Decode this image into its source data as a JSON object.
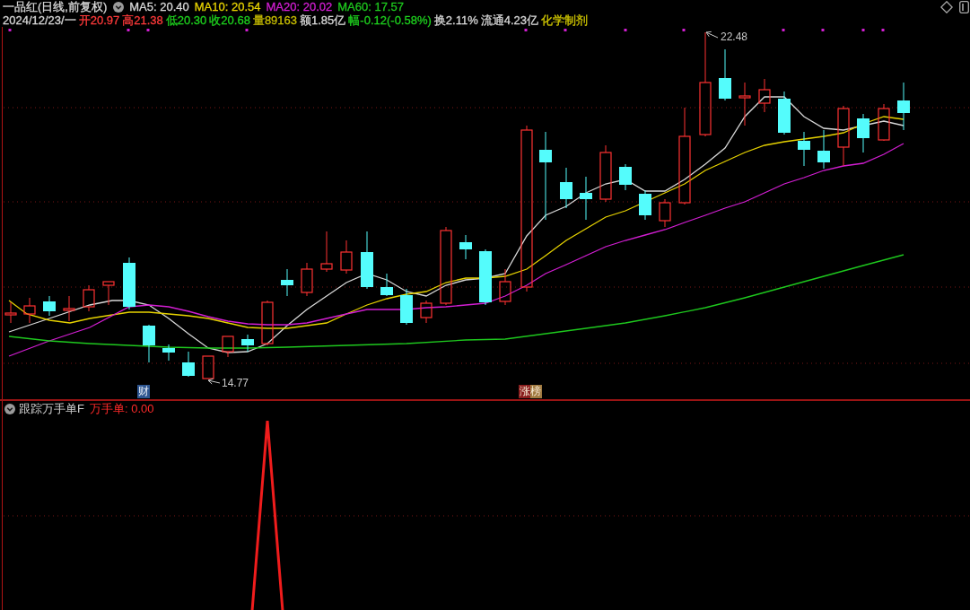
{
  "header": {
    "title": "一品红(日线,前复权)",
    "moving_averages": [
      {
        "text": "MA5: 20.40",
        "color": "#d8d8d8"
      },
      {
        "text": "MA10: 20.54",
        "color": "#e6d200"
      },
      {
        "text": "MA20: 20.02",
        "color": "#d21ed2"
      },
      {
        "text": "MA60: 17.57",
        "color": "#1ec81e"
      }
    ],
    "quote": [
      {
        "text": "2024/12/23/一",
        "color": "#d8d8d8"
      },
      {
        "text": "开20.97",
        "color": "#ff3a3a"
      },
      {
        "text": "高21.38",
        "color": "#ff3a3a"
      },
      {
        "text": "低20.30",
        "color": "#1ed21e"
      },
      {
        "text": "收20.68",
        "color": "#1ed21e"
      },
      {
        "text": "量89163",
        "color": "#c8be00"
      },
      {
        "text": "额1.85亿",
        "color": "#d8d8d8"
      },
      {
        "text": "幅-0.12(-0.58%)",
        "color": "#1ed21e"
      },
      {
        "text": "换2.11%",
        "color": "#d8d8d8"
      },
      {
        "text": "流通4.23亿",
        "color": "#d8d8d8"
      },
      {
        "text": "化学制剂",
        "color": "#d2c800"
      }
    ]
  },
  "chart": {
    "price_labels": [
      {
        "text": "22.48"
      },
      {
        "text": "14.77"
      }
    ],
    "tags": [
      {
        "text": "财",
        "kind": "finance"
      },
      {
        "text": "涨榜",
        "kind": "ranking"
      }
    ]
  },
  "indicator": {
    "title": "跟踪万手单F",
    "value": "万手单: 0.00"
  }
}
